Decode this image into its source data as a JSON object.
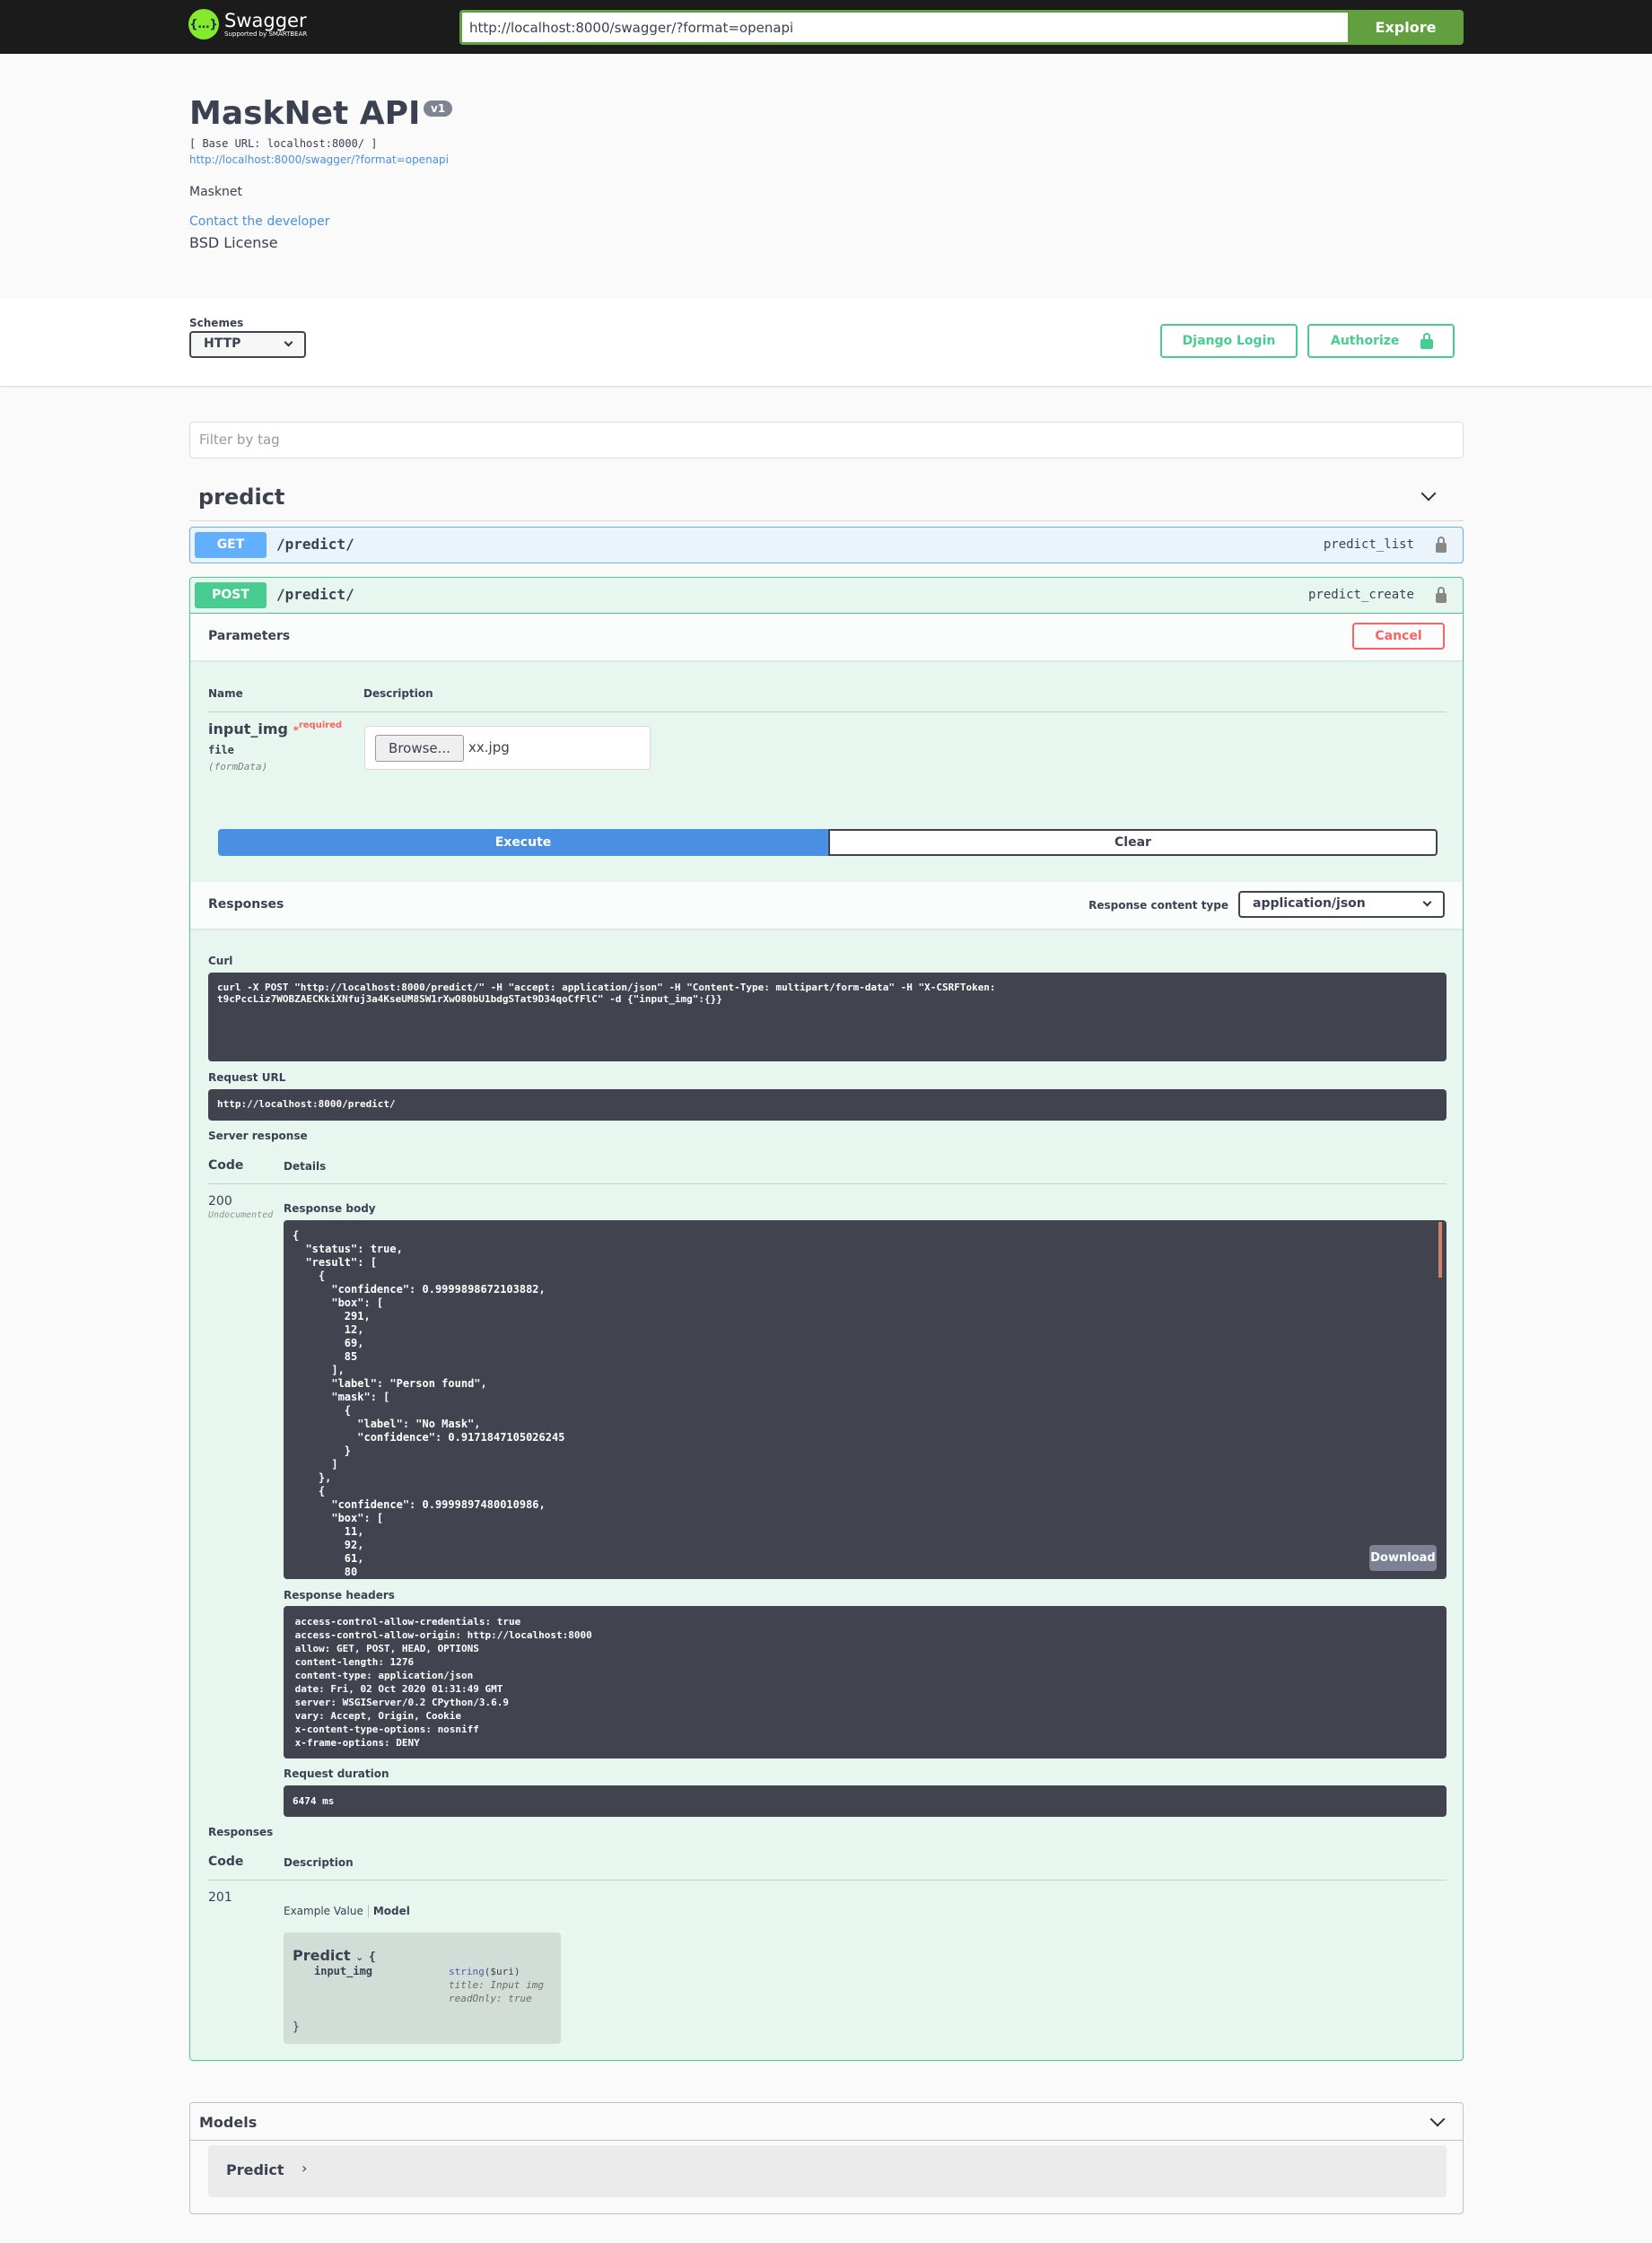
{
  "topbar": {
    "logo_text": "Swagger",
    "logo_sub": "Supported by SMARTBEAR",
    "url": "http://localhost:8000/swagger/?format=openapi",
    "explore": "Explore"
  },
  "info": {
    "title": "MaskNet API",
    "version": "v1",
    "base_url": "[ Base URL: localhost:8000/ ]",
    "spec_link": "http://localhost:8000/swagger/?format=openapi",
    "description": "Masknet",
    "contact": "Contact the developer",
    "license": "BSD License"
  },
  "schemes": {
    "label": "Schemes",
    "selected": "HTTP",
    "django_login": "Django Login",
    "authorize": "Authorize"
  },
  "filter": {
    "placeholder": "Filter by tag"
  },
  "tag": {
    "name": "predict"
  },
  "get_op": {
    "method": "GET",
    "path": "/predict/",
    "operation_id": "predict_list"
  },
  "post_op": {
    "method": "POST",
    "path": "/predict/",
    "operation_id": "predict_create",
    "parameters_label": "Parameters",
    "cancel": "Cancel",
    "col_name": "Name",
    "col_desc": "Description",
    "param": {
      "name": "input_img",
      "required_mark": "*",
      "required": "required",
      "type": "file",
      "in": "(formData)",
      "browse": "Browse...",
      "file": "xx.jpg"
    },
    "execute": "Execute",
    "clear": "Clear",
    "responses_label": "Responses",
    "content_type_label": "Response content type",
    "content_type": "application/json",
    "curl_label": "Curl",
    "curl": "curl -X POST \"http://localhost:8000/predict/\" -H \"accept: application/json\" -H \"Content-Type: multipart/form-data\" -H \"X-CSRFToken:\nt9cPccLiz7WOBZAECKkiXNfuj3a4KseUM8SW1rXwO80bU1bdgSTat9D34qoCfFlC\" -d {\"input_img\":{}}",
    "request_url_label": "Request URL",
    "request_url": "http://localhost:8000/predict/",
    "server_response_label": "Server response",
    "code_col": "Code",
    "details_col": "Details",
    "status_code": "200",
    "status_note": "Undocumented",
    "body_label": "Response body",
    "body": "{\n  \"status\": true,\n  \"result\": [\n    {\n      \"confidence\": 0.9999898672103882,\n      \"box\": [\n        291,\n        12,\n        69,\n        85\n      ],\n      \"label\": \"Person found\",\n      \"mask\": [\n        {\n          \"label\": \"No Mask\",\n          \"confidence\": 0.9171847105026245\n        }\n      ]\n    },\n    {\n      \"confidence\": 0.9999897480010986,\n      \"box\": [\n        11,\n        92,\n        61,\n        80",
    "download": "Download",
    "headers_label": "Response headers",
    "headers": " access-control-allow-credentials: true\n access-control-allow-origin: http://localhost:8000\n allow: GET, POST, HEAD, OPTIONS\n content-length: 1276\n content-type: application/json\n date: Fri, 02 Oct 2020 01:31:49 GMT\n server: WSGIServer/0.2 CPython/3.6.9\n vary: Accept, Origin, Cookie\n x-content-type-options: nosniff\n x-frame-options: DENY",
    "duration_label": "Request duration",
    "duration": "6474 ms",
    "responses2_label": "Responses",
    "desc_col": "Description",
    "code201": "201",
    "example_value": "Example Value",
    "model_tab": "Model",
    "model": {
      "name": "Predict",
      "open": "{",
      "field": "input_img",
      "type": "string",
      "format": "($uri)",
      "title": "title: Input img",
      "readonly": "readOnly: true",
      "close": "}"
    }
  },
  "models": {
    "label": "Models",
    "item": "Predict"
  }
}
